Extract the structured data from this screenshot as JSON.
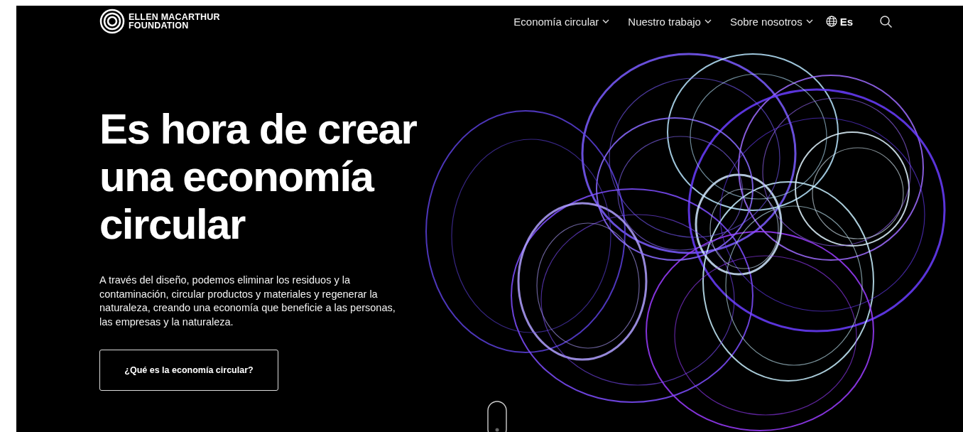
{
  "header": {
    "logo_text": [
      "ELLEN MACARTHUR",
      "FOUNDATION"
    ],
    "nav": [
      {
        "label": "Economía circular"
      },
      {
        "label": "Nuestro trabajo"
      },
      {
        "label": "Sobre nosotros"
      }
    ],
    "language": "Es"
  },
  "hero": {
    "title": "Es hora de crear una economía circular",
    "body": "A través del diseño, podemos eliminar los residuos y la contaminación, circular productos y materiales y regenerar la naturaleza, creando una economía que beneficie a las personas, las empresas y la naturaleza.",
    "button": "¿Qué es la economía circular?"
  }
}
